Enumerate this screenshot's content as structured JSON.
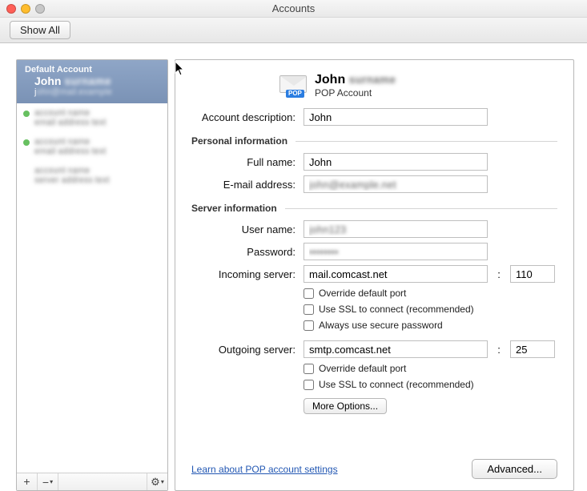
{
  "window": {
    "title": "Accounts",
    "show_all": "Show All"
  },
  "sidebar": {
    "default_label": "Default Account",
    "selected": {
      "name": "John",
      "sub": "j"
    },
    "others": [
      {
        "has_dot": true,
        "line1": "account name",
        "line2": "email address text"
      },
      {
        "has_dot": true,
        "line1": "account name",
        "line2": "email address text"
      },
      {
        "has_dot": false,
        "line1": "account name",
        "line2": "server address text"
      }
    ],
    "footer": {
      "add": "+",
      "remove": "−",
      "menu": "▾",
      "gear": "⚙",
      "gear_menu": "▾"
    }
  },
  "header": {
    "name": "John",
    "kind": "POP Account",
    "badge": "POP"
  },
  "form": {
    "description_label": "Account description:",
    "description_value": "John",
    "personal_title": "Personal information",
    "fullname_label": "Full name:",
    "fullname_value": "John",
    "email_label": "E-mail address:",
    "email_value": "john@example.net",
    "server_title": "Server information",
    "username_label": "User name:",
    "username_value": "john123",
    "password_label": "Password:",
    "password_value": "••••••••",
    "incoming_label": "Incoming server:",
    "incoming_value": "mail.comcast.net",
    "incoming_port": "110",
    "outgoing_label": "Outgoing server:",
    "outgoing_value": "smtp.comcast.net",
    "outgoing_port": "25",
    "colon": ":",
    "chk_override": "Override default port",
    "chk_ssl": "Use SSL to connect (recommended)",
    "chk_secure": "Always use secure password",
    "more_options": "More Options..."
  },
  "footer": {
    "learn_link": "Learn about POP account settings",
    "advanced": "Advanced..."
  }
}
